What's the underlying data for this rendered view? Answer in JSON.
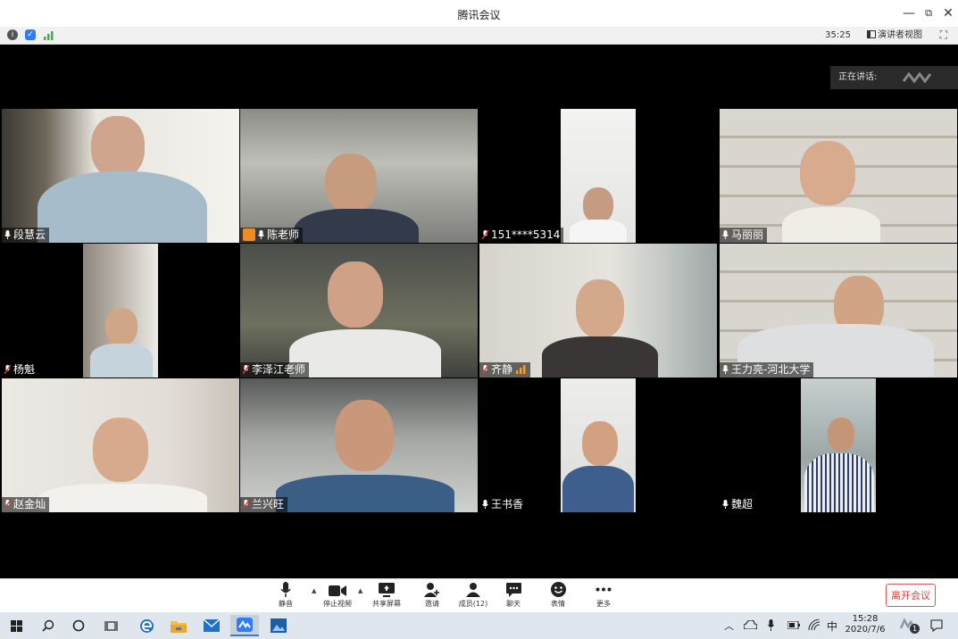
{
  "window": {
    "title": "腾讯会议",
    "minimize": "—",
    "restore": "⧉",
    "close": "✕"
  },
  "infobar": {
    "timer": "35:25",
    "speaker_view": "演讲者视图"
  },
  "speaking": {
    "label": "正在讲话:"
  },
  "participants": [
    {
      "name": "段慧云",
      "mic": "on"
    },
    {
      "name": "陈老师",
      "mic": "on"
    },
    {
      "name": "151****5314",
      "mic": "muted"
    },
    {
      "name": "马丽丽",
      "mic": "on"
    },
    {
      "name": "杨魁",
      "mic": "muted"
    },
    {
      "name": "李泽江老师",
      "mic": "muted"
    },
    {
      "name": "齐静",
      "mic": "muted"
    },
    {
      "name": "王力亮-河北大学",
      "mic": "on"
    },
    {
      "name": "赵金灿",
      "mic": "muted"
    },
    {
      "name": "兰兴旺",
      "mic": "muted"
    },
    {
      "name": "王书香",
      "mic": "on"
    },
    {
      "name": "魏超",
      "mic": "on"
    }
  ],
  "toolbar": {
    "mute": "静音",
    "stop_video": "停止视频",
    "share_screen": "共享屏幕",
    "invite": "邀请",
    "members": "成员(12)",
    "chat": "聊天",
    "reactions": "表情",
    "more": "更多",
    "leave": "离开会议"
  },
  "taskbar": {
    "time": "15:28",
    "date": "2020/7/6",
    "ime": "中",
    "notification_count": "1"
  },
  "colors": {
    "accent": "#2f7cf6",
    "leave": "#e0403a",
    "speaking_bg": "#2a2a2a"
  }
}
